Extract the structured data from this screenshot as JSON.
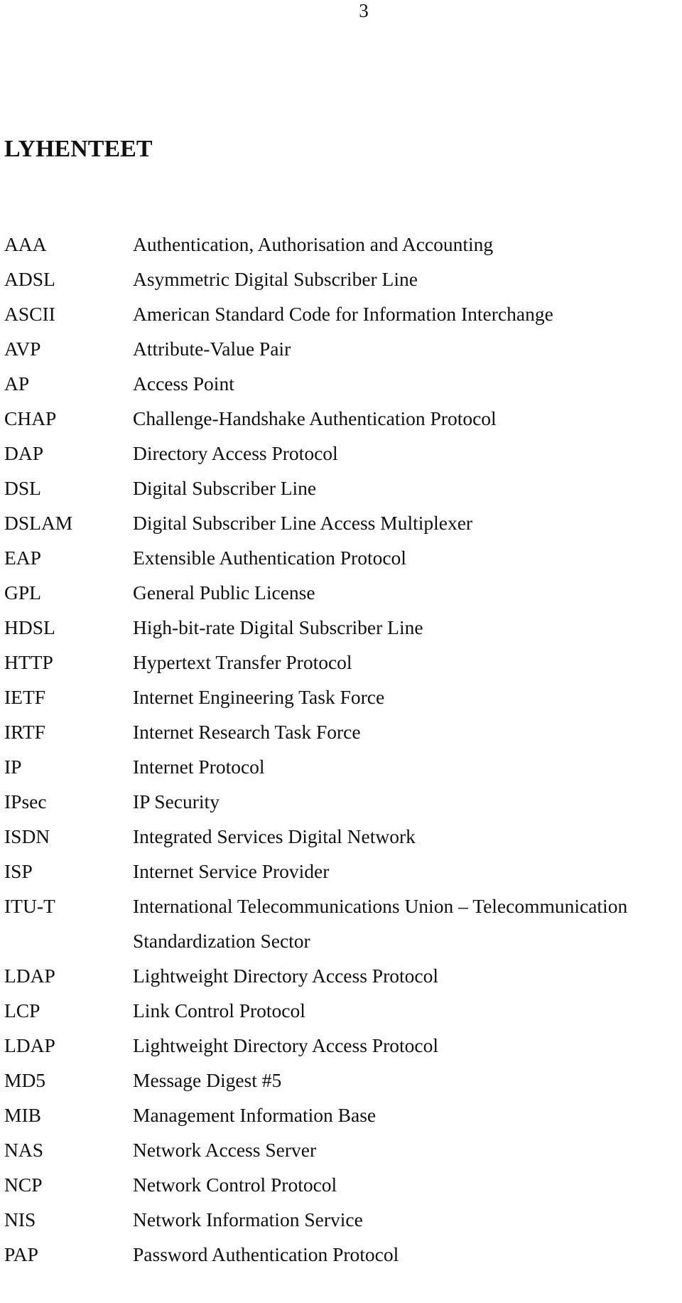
{
  "page": {
    "number": "3",
    "heading": "LYHENTEET"
  },
  "abbreviations": [
    {
      "abbr": "AAA",
      "desc": "Authentication, Authorisation and Accounting"
    },
    {
      "abbr": "ADSL",
      "desc": "Asymmetric Digital Subscriber Line"
    },
    {
      "abbr": "ASCII",
      "desc": "American Standard Code for Information Interchange"
    },
    {
      "abbr": "AVP",
      "desc": "Attribute-Value Pair"
    },
    {
      "abbr": "AP",
      "desc": "Access Point"
    },
    {
      "abbr": "CHAP",
      "desc": "Challenge-Handshake Authentication Protocol"
    },
    {
      "abbr": "DAP",
      "desc": "Directory Access Protocol"
    },
    {
      "abbr": "DSL",
      "desc": "Digital Subscriber Line"
    },
    {
      "abbr": "DSLAM",
      "desc": "Digital Subscriber Line Access Multiplexer"
    },
    {
      "abbr": "EAP",
      "desc": "Extensible Authentication Protocol"
    },
    {
      "abbr": "GPL",
      "desc": "General Public License"
    },
    {
      "abbr": "HDSL",
      "desc": "High-bit-rate Digital Subscriber Line"
    },
    {
      "abbr": "HTTP",
      "desc": "Hypertext Transfer Protocol"
    },
    {
      "abbr": "IETF",
      "desc": "Internet Engineering Task Force"
    },
    {
      "abbr": "IRTF",
      "desc": "Internet Research Task Force"
    },
    {
      "abbr": "IP",
      "desc": "Internet Protocol"
    },
    {
      "abbr": "IPsec",
      "desc": "IP Security"
    },
    {
      "abbr": "ISDN",
      "desc": "Integrated Services Digital Network"
    },
    {
      "abbr": "ISP",
      "desc": "Internet Service Provider"
    },
    {
      "abbr": "ITU-T",
      "desc": "International Telecommunications Union – Telecommunication",
      "desc_continued": "Standardization Sector"
    },
    {
      "abbr": "LDAP",
      "desc": "Lightweight Directory Access Protocol"
    },
    {
      "abbr": "LCP",
      "desc": "Link Control Protocol"
    },
    {
      "abbr": "LDAP",
      "desc": "Lightweight Directory Access Protocol"
    },
    {
      "abbr": "MD5",
      "desc": "Message Digest #5"
    },
    {
      "abbr": "MIB",
      "desc": "Management Information Base"
    },
    {
      "abbr": "NAS",
      "desc": "Network Access Server"
    },
    {
      "abbr": "NCP",
      "desc": "Network Control Protocol"
    },
    {
      "abbr": "NIS",
      "desc": "Network Information Service"
    },
    {
      "abbr": "PAP",
      "desc": "Password Authentication Protocol"
    }
  ]
}
